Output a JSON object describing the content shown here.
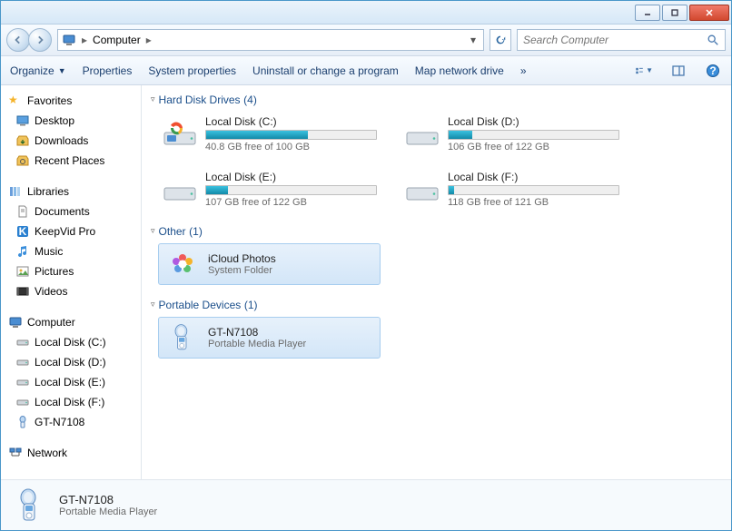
{
  "toolbar": {
    "organize": "Organize",
    "properties": "Properties",
    "sysprops": "System properties",
    "uninstall": "Uninstall or change a program",
    "mapdrive": "Map network drive",
    "chev": "»"
  },
  "address": {
    "root": "Computer",
    "chev": "▸",
    "dropdown": "▾"
  },
  "search": {
    "placeholder": "Search Computer"
  },
  "nav": {
    "favorites": "Favorites",
    "desktop": "Desktop",
    "downloads": "Downloads",
    "recent": "Recent Places",
    "libraries": "Libraries",
    "documents": "Documents",
    "keepvid": "KeepVid Pro",
    "music": "Music",
    "pictures": "Pictures",
    "videos": "Videos",
    "computer": "Computer",
    "ldc": "Local Disk (C:)",
    "ldd": "Local Disk (D:)",
    "lde": "Local Disk (E:)",
    "ldf": "Local Disk (F:)",
    "gtn": "GT-N7108",
    "network": "Network"
  },
  "sections": {
    "hdd": {
      "label": "Hard Disk Drives",
      "count": "(4)"
    },
    "other": {
      "label": "Other",
      "count": "(1)"
    },
    "portable": {
      "label": "Portable Devices",
      "count": "(1)"
    }
  },
  "drives": {
    "c": {
      "name": "Local Disk (C:)",
      "meta": "40.8 GB free of 100 GB",
      "fillPct": 60
    },
    "d": {
      "name": "Local Disk (D:)",
      "meta": "106 GB free of 122 GB",
      "fillPct": 14
    },
    "e": {
      "name": "Local Disk (E:)",
      "meta": "107 GB free of 122 GB",
      "fillPct": 13
    },
    "f": {
      "name": "Local Disk (F:)",
      "meta": "118 GB free of 121 GB",
      "fillPct": 3
    }
  },
  "other": {
    "icloud": {
      "name": "iCloud Photos",
      "meta": "System Folder"
    }
  },
  "portable": {
    "gtn": {
      "name": "GT-N7108",
      "meta": "Portable Media Player"
    }
  },
  "details": {
    "name": "GT-N7108",
    "meta": "Portable Media Player"
  }
}
